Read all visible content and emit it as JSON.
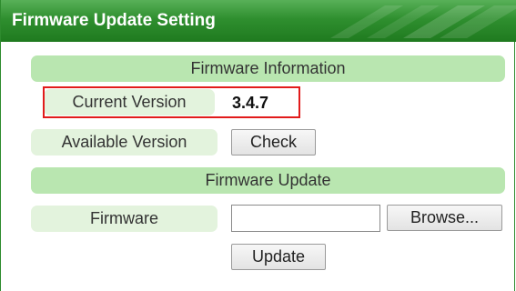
{
  "header": {
    "title": "Firmware Update Setting"
  },
  "firmware_information": {
    "section_title": "Firmware Information",
    "current_version_label": "Current Version",
    "current_version_value": "3.4.7",
    "available_version_label": "Available Version",
    "check_button": "Check"
  },
  "firmware_update": {
    "section_title": "Firmware Update",
    "firmware_label": "Firmware",
    "firmware_file_value": "",
    "browse_button": "Browse...",
    "update_button": "Update"
  },
  "colors": {
    "header_green": "#2f8f2f",
    "section_bar": "#b9e6b0",
    "label_bg": "#e3f3dd",
    "highlight_red": "#e21b1b"
  }
}
